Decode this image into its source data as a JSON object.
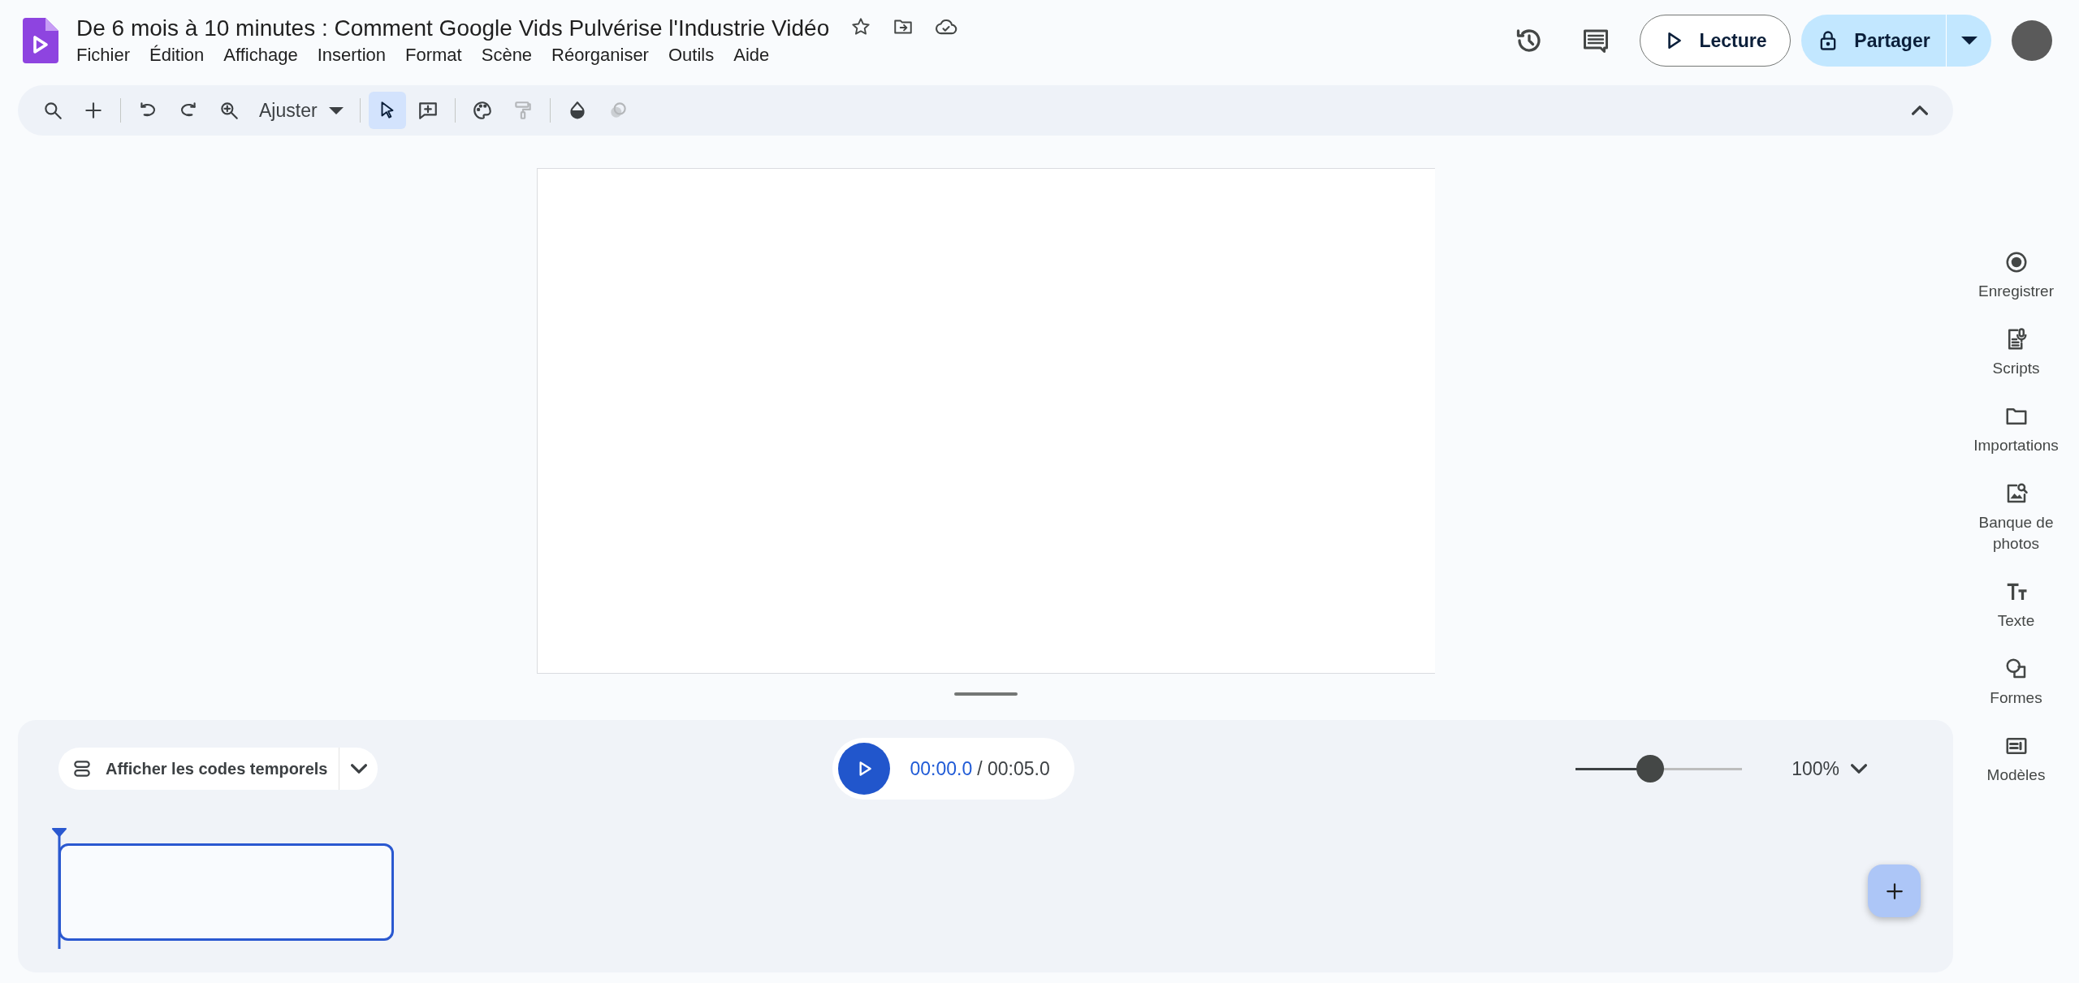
{
  "document": {
    "title": "De 6 mois à 10 minutes : Comment Google Vids Pulvérise l'Industrie Vidéo"
  },
  "menu": [
    "Fichier",
    "Édition",
    "Affichage",
    "Insertion",
    "Format",
    "Scène",
    "Réorganiser",
    "Outils",
    "Aide"
  ],
  "header_actions": {
    "play_label": "Lecture",
    "share_label": "Partager"
  },
  "toolbar": {
    "zoom_label": "Ajuster",
    "items": [
      {
        "selected": false,
        "disabled": false
      },
      {
        "selected": false,
        "disabled": false
      },
      {
        "selected": false,
        "disabled": false
      },
      {
        "selected": false,
        "disabled": false
      },
      {
        "selected": false,
        "disabled": false
      },
      {
        "selected": true,
        "disabled": false
      },
      {
        "selected": false,
        "disabled": false
      },
      {
        "selected": false,
        "disabled": false
      },
      {
        "selected": false,
        "disabled": true
      },
      {
        "selected": false,
        "disabled": false
      },
      {
        "selected": false,
        "disabled": true
      }
    ]
  },
  "sidebar": {
    "items": [
      {
        "label": "Enregistrer"
      },
      {
        "label": "Scripts"
      },
      {
        "label": "Importations"
      },
      {
        "label": "Banque de photos"
      },
      {
        "label": "Texte"
      },
      {
        "label": "Formes"
      },
      {
        "label": "Modèles"
      }
    ]
  },
  "timeline": {
    "timecodes_label": "Afficher les codes temporels",
    "current_time": "00:00.0",
    "total_time": "/ 00:05.0",
    "zoom": {
      "level": 0.45,
      "reading": "100%"
    },
    "scenes": [
      {
        "selected": true
      }
    ]
  }
}
